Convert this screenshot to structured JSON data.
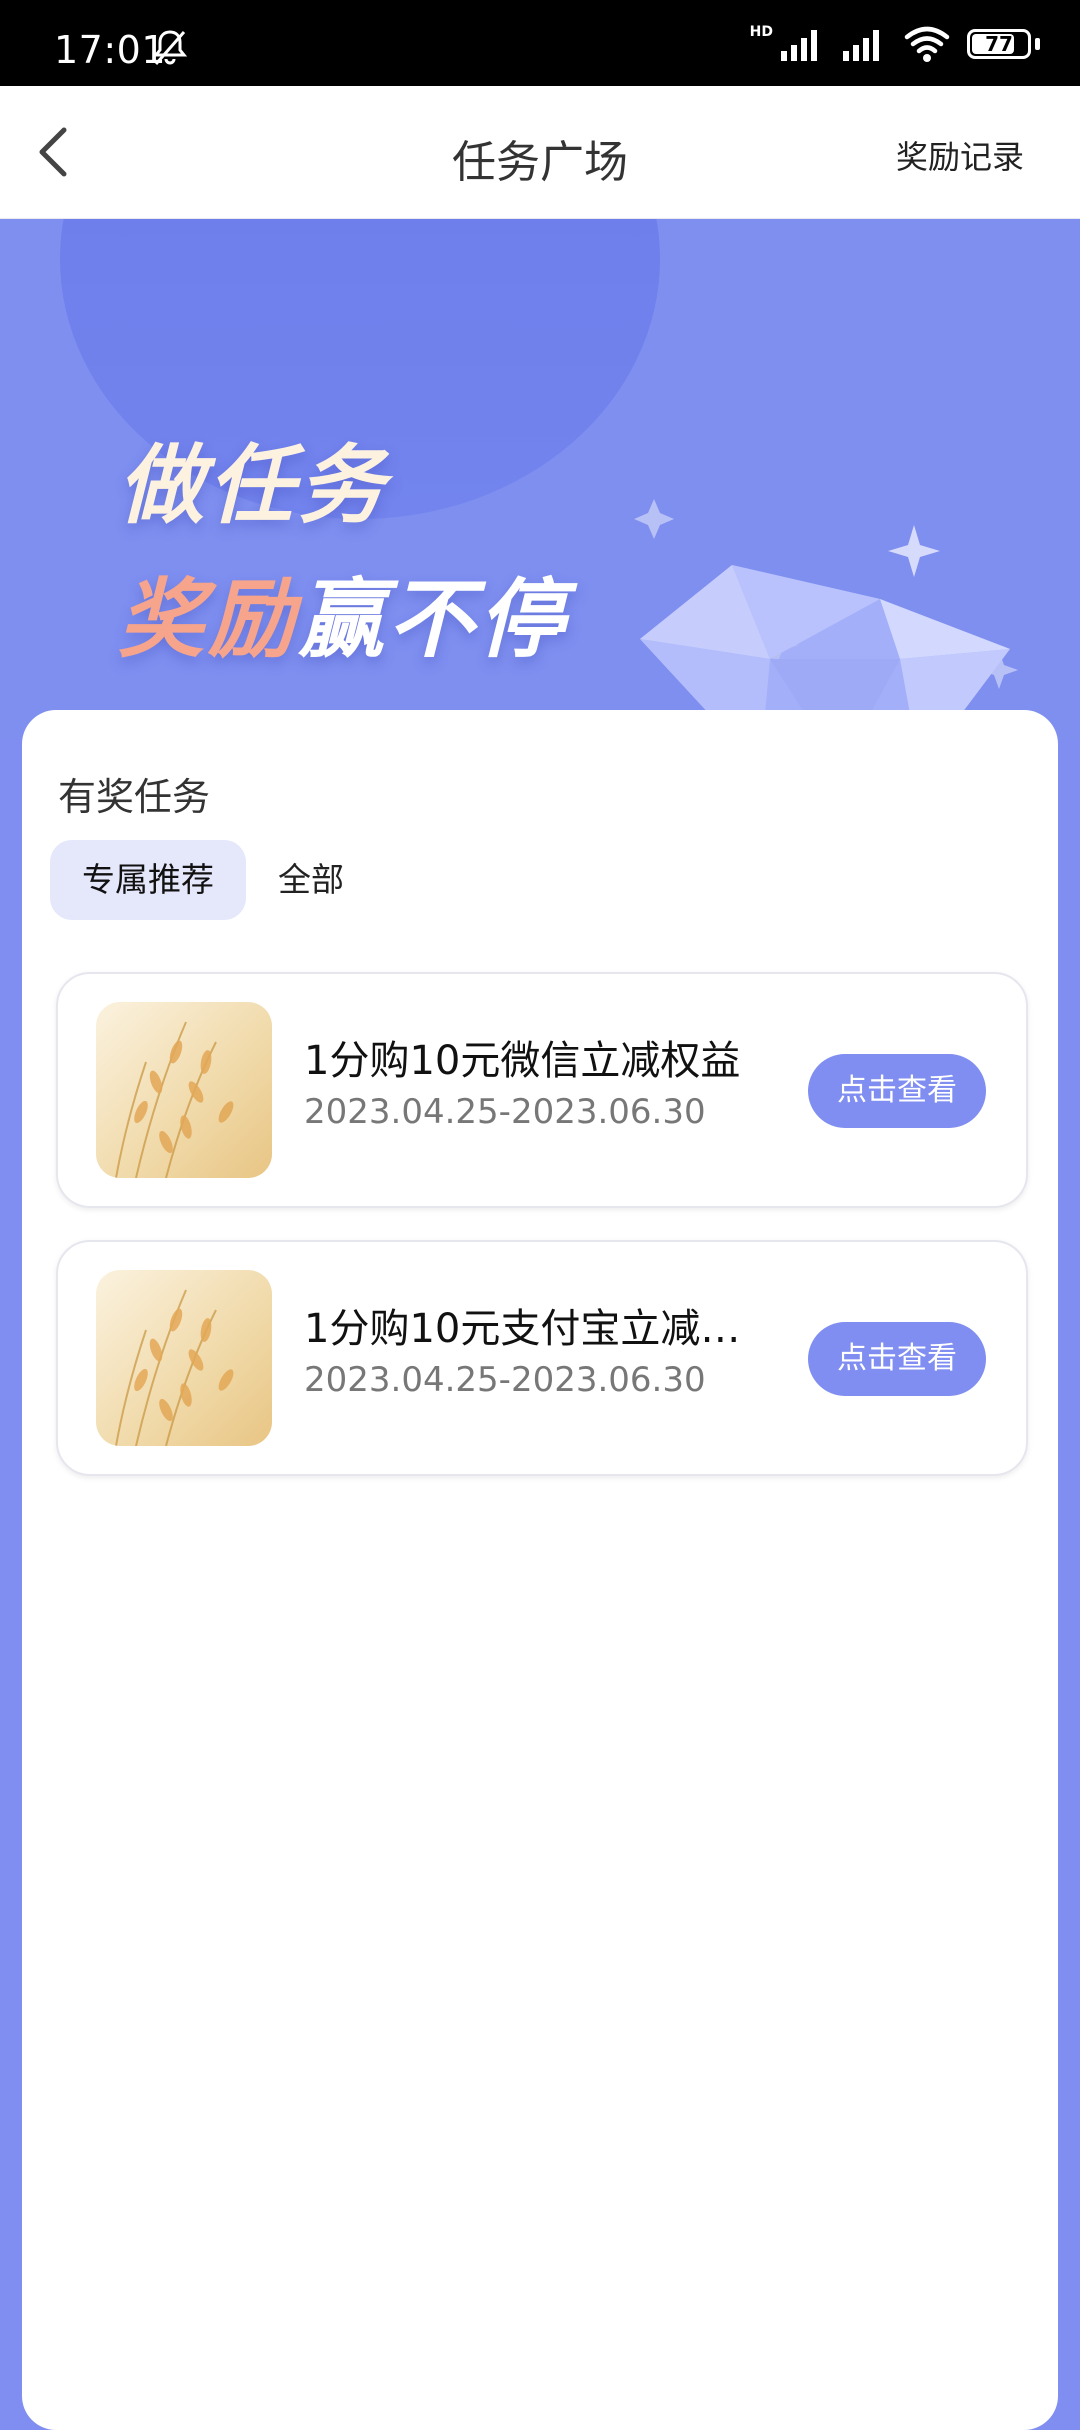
{
  "status_bar": {
    "time": "17:01",
    "hd": "HD",
    "battery": "77"
  },
  "header": {
    "title": "任务广场",
    "records_label": "奖励记录"
  },
  "banner": {
    "slogan_line1": "做任务",
    "slogan_line2a": "奖励",
    "slogan_line2b": "赢不停"
  },
  "section": {
    "title": "有奖任务"
  },
  "tabs": [
    {
      "label": "专属推荐",
      "active": true
    },
    {
      "label": "全部",
      "active": false
    }
  ],
  "tasks": [
    {
      "name": "1分购10元微信立减权益",
      "date": "2023.04.25-2023.06.30",
      "button": "点击查看"
    },
    {
      "name": "1分购10元支付宝立减…",
      "date": "2023.04.25-2023.06.30",
      "button": "点击查看"
    }
  ],
  "colors": {
    "accent": "#7f8ef0",
    "tab_active_bg": "#e5e7fb",
    "slogan_orange": "#f6a48b"
  },
  "icons": [
    "back-arrow-icon",
    "mute-bell-icon",
    "signal-icon",
    "wifi-icon",
    "battery-icon",
    "diamond-illustration"
  ]
}
